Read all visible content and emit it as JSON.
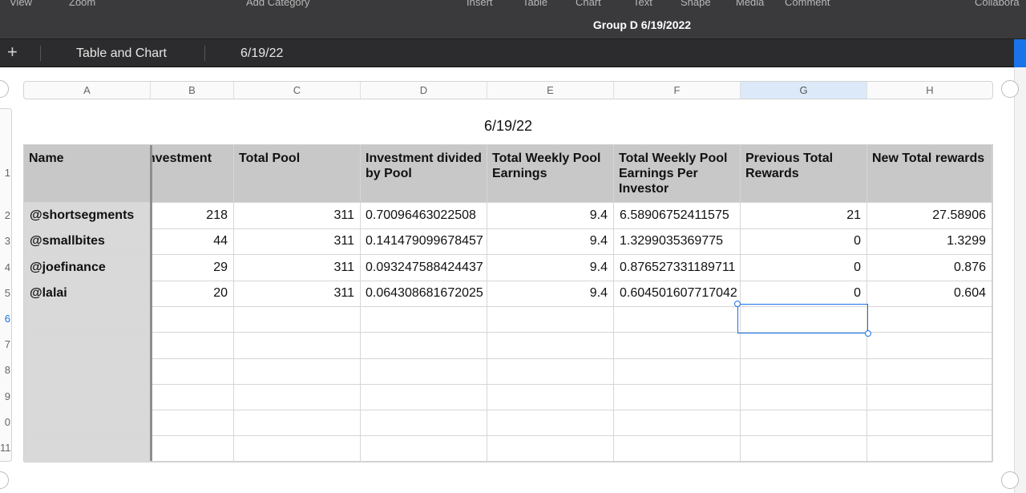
{
  "toolbar": {
    "items": [
      "View",
      "Zoom",
      "Add Category",
      "Insert",
      "Table",
      "Chart",
      "Text",
      "Shape",
      "Media",
      "Comment",
      "Collabora"
    ]
  },
  "document": {
    "title": "Group D 6/19/2022"
  },
  "sheets": {
    "add_label": "+",
    "tabs": [
      "Table and Chart",
      "6/19/22"
    ]
  },
  "columns": [
    "A",
    "B",
    "C",
    "D",
    "E",
    "F",
    "G",
    "H"
  ],
  "rows": [
    "1",
    "2",
    "3",
    "4",
    "5",
    "6",
    "7",
    "8",
    "9",
    "0",
    "11"
  ],
  "table": {
    "title": "6/19/22",
    "headers": [
      "Name",
      "nvestment",
      "Total Pool",
      "Investment divided by Pool",
      "Total Weekly Pool Earnings",
      "Total Weekly Pool Earnings Per Investor",
      "Previous Total Rewards",
      "New Total rewards"
    ],
    "data": [
      [
        "@shortsegments",
        "218",
        "311",
        "0.70096463022508",
        "9.4",
        "6.58906752411575",
        "21",
        "27.58906"
      ],
      [
        "@smallbites",
        "44",
        "311",
        "0.141479099678457",
        "9.4",
        "1.3299035369775",
        "0",
        "1.3299"
      ],
      [
        "@joefinance",
        "29",
        "311",
        "0.093247588424437",
        "9.4",
        "0.876527331189711",
        "0",
        "0.876"
      ],
      [
        "@lalai",
        "20",
        "311",
        "0.064308681672025",
        "9.4",
        "0.604501607717042",
        "0",
        "0.604"
      ]
    ]
  },
  "selection": {
    "cell": "G6"
  }
}
